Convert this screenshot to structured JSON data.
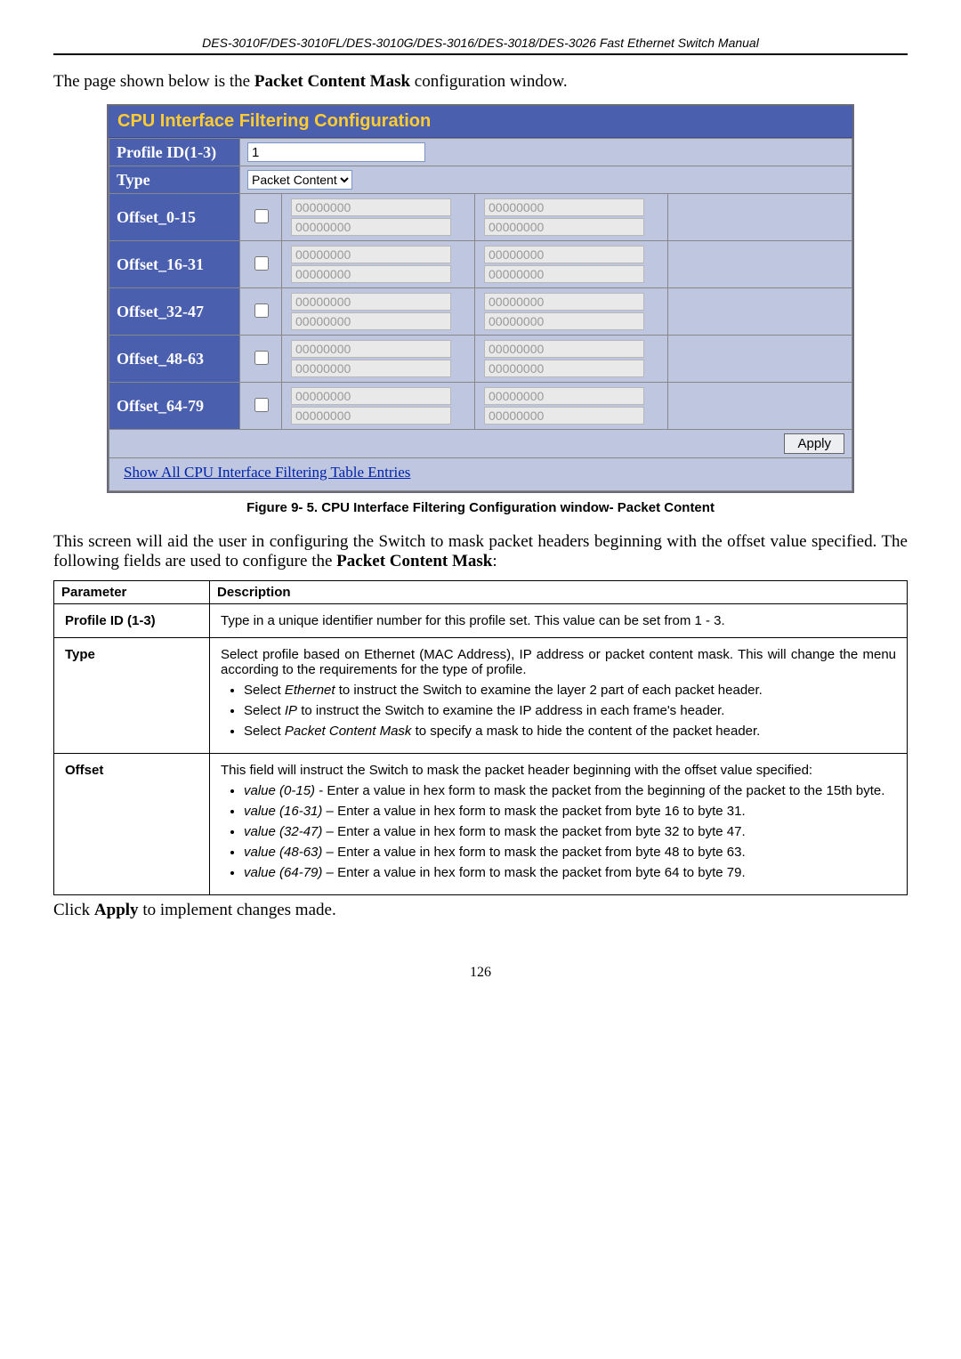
{
  "header": "DES-3010F/DES-3010FL/DES-3010G/DES-3016/DES-3018/DES-3026 Fast Ethernet Switch Manual",
  "intro_pre": "The page shown below is the ",
  "intro_bold": "Packet Content Mask",
  "intro_post": " configuration window.",
  "panel": {
    "title": "CPU Interface Filtering Configuration",
    "profile_label": "Profile ID(1-3)",
    "profile_value": "1",
    "type_label": "Type",
    "type_value": "Packet Content",
    "offsets": [
      {
        "label": "Offset_0-15"
      },
      {
        "label": "Offset_16-31"
      },
      {
        "label": "Offset_32-47"
      },
      {
        "label": "Offset_48-63"
      },
      {
        "label": "Offset_64-79"
      }
    ],
    "disabled_value": "00000000",
    "apply": "Apply",
    "link": "Show All CPU Interface Filtering Table Entries"
  },
  "caption": "Figure 9- 5. CPU Interface Filtering Configuration window- Packet Content",
  "body_pre": "This screen will aid the user in configuring the Switch to mask packet headers beginning with the offset value specified. The following fields are used to configure the ",
  "body_bold": "Packet Content Mask",
  "body_post": ":",
  "table": {
    "h1": "Parameter",
    "h2": "Description",
    "r1_name": "Profile ID (1-3)",
    "r1_desc": "Type in a unique identifier number for this profile set. This value can be set from 1 - 3.",
    "r2_name": "Type",
    "r2_desc": "Select profile based on Ethernet (MAC Address), IP address or packet content mask. This will change the menu according to the requirements for the type of profile.",
    "r2_b1_pre": "Select ",
    "r2_b1_em": "Ethernet",
    "r2_b1_post": " to instruct the Switch to examine the layer 2 part of each packet header.",
    "r2_b2_pre": "Select ",
    "r2_b2_em": "IP",
    "r2_b2_post": " to instruct the Switch to examine the IP address in each frame's header.",
    "r2_b3_pre": "Select ",
    "r2_b3_em": "Packet Content Mask",
    "r2_b3_post": " to specify a mask to hide the content of the packet header.",
    "r3_name": "Offset",
    "r3_desc": "This field will instruct the Switch to mask the packet header beginning with the offset value specified:",
    "r3_b1_em": "value (0-15)",
    "r3_b1_post": " - Enter a value in hex form to mask the packet from the beginning of the packet to the 15th byte.",
    "r3_b2_em": "value (16-31)",
    "r3_b2_post": " – Enter a value in hex form to mask the packet from byte 16 to byte 31.",
    "r3_b3_em": "value (32-47)",
    "r3_b3_post": " – Enter a value in hex form to mask the packet from byte 32 to byte 47.",
    "r3_b4_em": "value (48-63)",
    "r3_b4_post": " – Enter a value in hex form to mask the packet from byte 48 to byte 63.",
    "r3_b5_em": "value (64-79)",
    "r3_b5_post": " – Enter a value in hex form to mask the packet from byte 64 to byte 79."
  },
  "closing_pre": "Click ",
  "closing_bold": "Apply",
  "closing_post": " to implement changes made.",
  "page_number": "126"
}
